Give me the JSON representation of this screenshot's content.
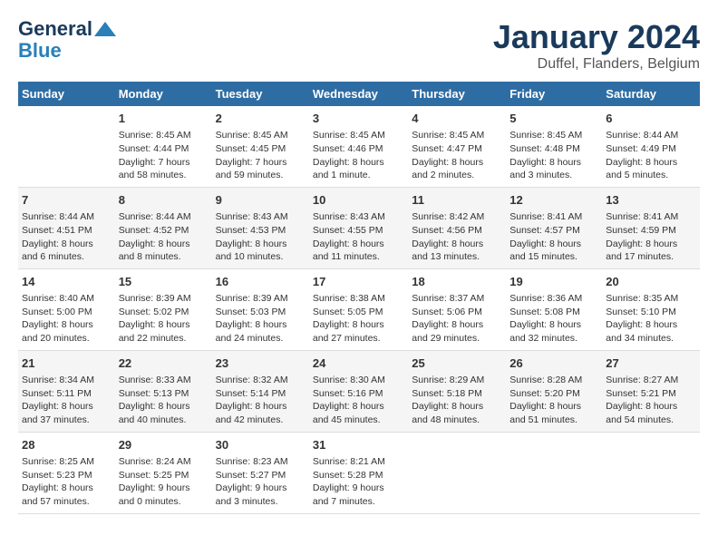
{
  "header": {
    "logo_line1": "General",
    "logo_line2": "Blue",
    "main_title": "January 2024",
    "subtitle": "Duffel, Flanders, Belgium"
  },
  "calendar": {
    "days_of_week": [
      "Sunday",
      "Monday",
      "Tuesday",
      "Wednesday",
      "Thursday",
      "Friday",
      "Saturday"
    ],
    "weeks": [
      [
        {
          "day": "",
          "info": ""
        },
        {
          "day": "1",
          "info": "Sunrise: 8:45 AM\nSunset: 4:44 PM\nDaylight: 7 hours\nand 58 minutes."
        },
        {
          "day": "2",
          "info": "Sunrise: 8:45 AM\nSunset: 4:45 PM\nDaylight: 7 hours\nand 59 minutes."
        },
        {
          "day": "3",
          "info": "Sunrise: 8:45 AM\nSunset: 4:46 PM\nDaylight: 8 hours\nand 1 minute."
        },
        {
          "day": "4",
          "info": "Sunrise: 8:45 AM\nSunset: 4:47 PM\nDaylight: 8 hours\nand 2 minutes."
        },
        {
          "day": "5",
          "info": "Sunrise: 8:45 AM\nSunset: 4:48 PM\nDaylight: 8 hours\nand 3 minutes."
        },
        {
          "day": "6",
          "info": "Sunrise: 8:44 AM\nSunset: 4:49 PM\nDaylight: 8 hours\nand 5 minutes."
        }
      ],
      [
        {
          "day": "7",
          "info": "Sunrise: 8:44 AM\nSunset: 4:51 PM\nDaylight: 8 hours\nand 6 minutes."
        },
        {
          "day": "8",
          "info": "Sunrise: 8:44 AM\nSunset: 4:52 PM\nDaylight: 8 hours\nand 8 minutes."
        },
        {
          "day": "9",
          "info": "Sunrise: 8:43 AM\nSunset: 4:53 PM\nDaylight: 8 hours\nand 10 minutes."
        },
        {
          "day": "10",
          "info": "Sunrise: 8:43 AM\nSunset: 4:55 PM\nDaylight: 8 hours\nand 11 minutes."
        },
        {
          "day": "11",
          "info": "Sunrise: 8:42 AM\nSunset: 4:56 PM\nDaylight: 8 hours\nand 13 minutes."
        },
        {
          "day": "12",
          "info": "Sunrise: 8:41 AM\nSunset: 4:57 PM\nDaylight: 8 hours\nand 15 minutes."
        },
        {
          "day": "13",
          "info": "Sunrise: 8:41 AM\nSunset: 4:59 PM\nDaylight: 8 hours\nand 17 minutes."
        }
      ],
      [
        {
          "day": "14",
          "info": "Sunrise: 8:40 AM\nSunset: 5:00 PM\nDaylight: 8 hours\nand 20 minutes."
        },
        {
          "day": "15",
          "info": "Sunrise: 8:39 AM\nSunset: 5:02 PM\nDaylight: 8 hours\nand 22 minutes."
        },
        {
          "day": "16",
          "info": "Sunrise: 8:39 AM\nSunset: 5:03 PM\nDaylight: 8 hours\nand 24 minutes."
        },
        {
          "day": "17",
          "info": "Sunrise: 8:38 AM\nSunset: 5:05 PM\nDaylight: 8 hours\nand 27 minutes."
        },
        {
          "day": "18",
          "info": "Sunrise: 8:37 AM\nSunset: 5:06 PM\nDaylight: 8 hours\nand 29 minutes."
        },
        {
          "day": "19",
          "info": "Sunrise: 8:36 AM\nSunset: 5:08 PM\nDaylight: 8 hours\nand 32 minutes."
        },
        {
          "day": "20",
          "info": "Sunrise: 8:35 AM\nSunset: 5:10 PM\nDaylight: 8 hours\nand 34 minutes."
        }
      ],
      [
        {
          "day": "21",
          "info": "Sunrise: 8:34 AM\nSunset: 5:11 PM\nDaylight: 8 hours\nand 37 minutes."
        },
        {
          "day": "22",
          "info": "Sunrise: 8:33 AM\nSunset: 5:13 PM\nDaylight: 8 hours\nand 40 minutes."
        },
        {
          "day": "23",
          "info": "Sunrise: 8:32 AM\nSunset: 5:14 PM\nDaylight: 8 hours\nand 42 minutes."
        },
        {
          "day": "24",
          "info": "Sunrise: 8:30 AM\nSunset: 5:16 PM\nDaylight: 8 hours\nand 45 minutes."
        },
        {
          "day": "25",
          "info": "Sunrise: 8:29 AM\nSunset: 5:18 PM\nDaylight: 8 hours\nand 48 minutes."
        },
        {
          "day": "26",
          "info": "Sunrise: 8:28 AM\nSunset: 5:20 PM\nDaylight: 8 hours\nand 51 minutes."
        },
        {
          "day": "27",
          "info": "Sunrise: 8:27 AM\nSunset: 5:21 PM\nDaylight: 8 hours\nand 54 minutes."
        }
      ],
      [
        {
          "day": "28",
          "info": "Sunrise: 8:25 AM\nSunset: 5:23 PM\nDaylight: 8 hours\nand 57 minutes."
        },
        {
          "day": "29",
          "info": "Sunrise: 8:24 AM\nSunset: 5:25 PM\nDaylight: 9 hours\nand 0 minutes."
        },
        {
          "day": "30",
          "info": "Sunrise: 8:23 AM\nSunset: 5:27 PM\nDaylight: 9 hours\nand 3 minutes."
        },
        {
          "day": "31",
          "info": "Sunrise: 8:21 AM\nSunset: 5:28 PM\nDaylight: 9 hours\nand 7 minutes."
        },
        {
          "day": "",
          "info": ""
        },
        {
          "day": "",
          "info": ""
        },
        {
          "day": "",
          "info": ""
        }
      ]
    ]
  }
}
